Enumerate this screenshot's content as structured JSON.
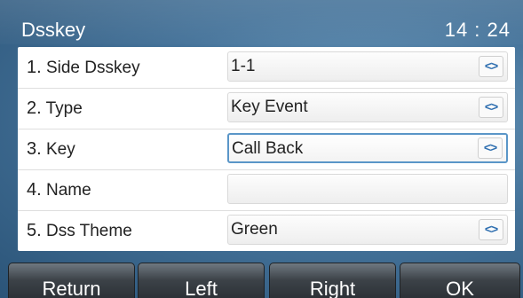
{
  "header": {
    "title": "Dsskey",
    "time": "14 : 24"
  },
  "rows": [
    {
      "number": "1.",
      "label": "Side Dsskey",
      "value": "1-1",
      "has_selector": true,
      "focused": false
    },
    {
      "number": "2.",
      "label": "Type",
      "value": "Key Event",
      "has_selector": true,
      "focused": false
    },
    {
      "number": "3.",
      "label": "Key",
      "value": "Call Back",
      "has_selector": true,
      "focused": true
    },
    {
      "number": "4.",
      "label": "Name",
      "value": "",
      "has_selector": false,
      "focused": false
    },
    {
      "number": "5.",
      "label": "Dss Theme",
      "value": "Green",
      "has_selector": true,
      "focused": false
    }
  ],
  "selector_icon": {
    "name": "left-right-arrows-icon",
    "glyph": "<>"
  },
  "softkeys": [
    "Return",
    "Left",
    "Right",
    "OK"
  ],
  "colors": {
    "focus_border": "#5a96c8",
    "arrow_icon": "#2f6fb0",
    "background": "#45739a"
  }
}
